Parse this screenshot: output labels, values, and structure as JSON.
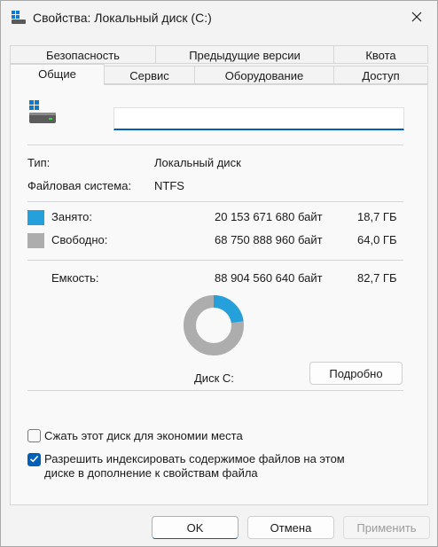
{
  "window": {
    "title": "Свойства: Локальный диск (C:)"
  },
  "tabs_row1": [
    "Безопасность",
    "Предыдущие версии",
    "Квота"
  ],
  "tabs_row2": [
    "Общие",
    "Сервис",
    "Оборудование",
    "Доступ"
  ],
  "active_tab": "Общие",
  "name_field": {
    "value": ""
  },
  "info": {
    "type_label": "Тип:",
    "type_value": "Локальный диск",
    "fs_label": "Файловая система:",
    "fs_value": "NTFS"
  },
  "usage": {
    "used": {
      "label": "Занято:",
      "bytes": "20 153 671 680 байт",
      "size": "18,7 ГБ",
      "color": "#26a0da"
    },
    "free": {
      "label": "Свободно:",
      "bytes": "68 750 888 960 байт",
      "size": "64,0 ГБ",
      "color": "#adadad"
    },
    "capacity": {
      "label": "Емкость:",
      "bytes": "88 904 560 640 байт",
      "size": "82,7 ГБ"
    },
    "used_fraction": 0.227
  },
  "disk_label": "Диск C:",
  "details_button": "Подробно",
  "options": {
    "compress": {
      "label": "Сжать этот диск для экономии места",
      "checked": false
    },
    "index": {
      "line1": "Разрешить индексировать содержимое файлов на этом",
      "line2": "диске в дополнение к свойствам файла",
      "checked": true
    }
  },
  "buttons": {
    "ok": "OK",
    "cancel": "Отмена",
    "apply": "Применить"
  },
  "icons": {
    "title": "drive-icon",
    "close": "close-icon",
    "drive": "drive-icon",
    "check": "check-icon"
  }
}
